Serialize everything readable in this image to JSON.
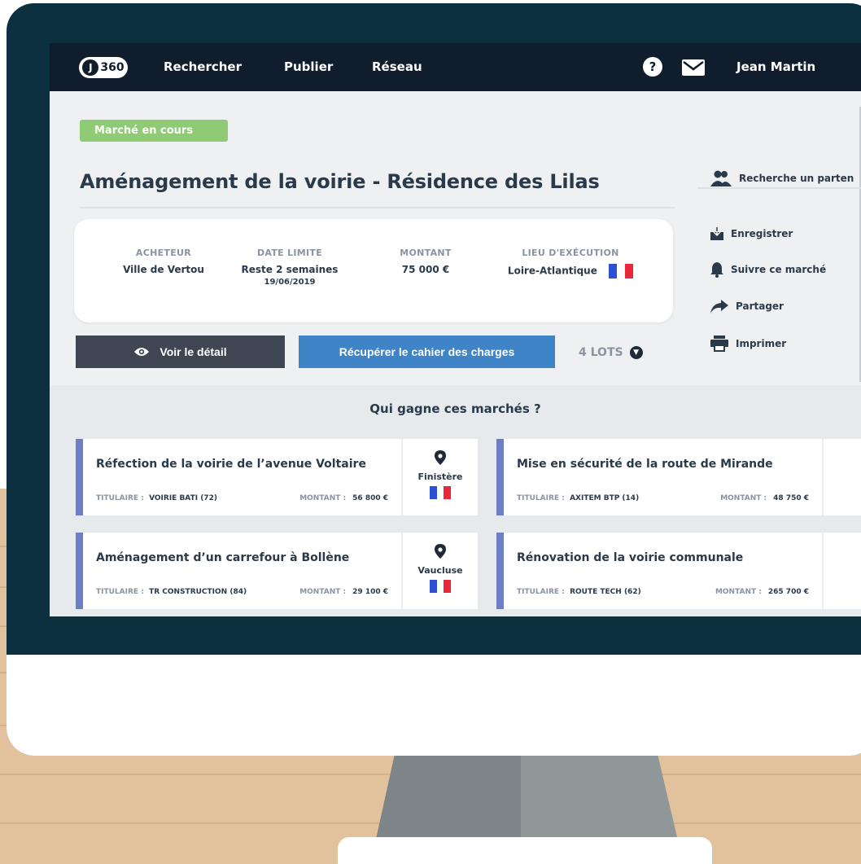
{
  "nav": {
    "logo": "360",
    "logo_letter": "J",
    "links": [
      "Rechercher",
      "Publier",
      "Réseau"
    ],
    "help": "?",
    "user": "Jean Martin"
  },
  "market": {
    "status": "Marché en cours",
    "title": "Aménagement de la voirie - Résidence des Lilas",
    "info": [
      {
        "label": "ACHETEUR",
        "value": "Ville de Vertou",
        "sub": ""
      },
      {
        "label": "DATE LIMITE",
        "value": "Reste 2 semaines",
        "sub": "19/06/2019"
      },
      {
        "label": "MONTANT",
        "value": "75 000 €",
        "sub": ""
      },
      {
        "label": "LIEU D'EXÉCUTION",
        "value": "Loire-Atlantique",
        "sub": ""
      }
    ],
    "detail_button": "Voir le détail",
    "cdc_button": "Récupérer le cahier des charges",
    "lots": "4 LOTS"
  },
  "actions": {
    "partner": "Recherche un parten",
    "save": "Enregistrer",
    "follow": "Suivre ce marché",
    "share": "Partager",
    "print": "Imprimer"
  },
  "winners": {
    "title": "Qui gagne ces marchés ?",
    "holder_label": "TITULAIRE :",
    "amount_label": "MONTANT :",
    "cards": [
      {
        "name": "Réfection de la voirie de l’avenue Voltaire",
        "holder": "VOIRIE BATI (72)",
        "amount": "56 800 €",
        "region": "Finistère"
      },
      {
        "name": "Mise en sécurité de la route de Mirande",
        "holder": "AXITEM BTP (14)",
        "amount": "48 750 €",
        "region": ""
      },
      {
        "name": "Aménagement d’un carrefour à Bollène",
        "holder": "TR CONSTRUCTION (84)",
        "amount": "29 100 €",
        "region": "Vaucluse"
      },
      {
        "name": "Rénovation de la voirie communale",
        "holder": "ROUTE TECH (62)",
        "amount": "265 700 €",
        "region": ""
      }
    ]
  },
  "colors": {
    "nav_bg": "#0f1d2c",
    "status_green": "#8fcb74",
    "primary_blue": "#3f84c6",
    "dark_button": "#3e4653",
    "accent_bar": "#6c7fc6",
    "monitor_frame": "#0c3040"
  }
}
